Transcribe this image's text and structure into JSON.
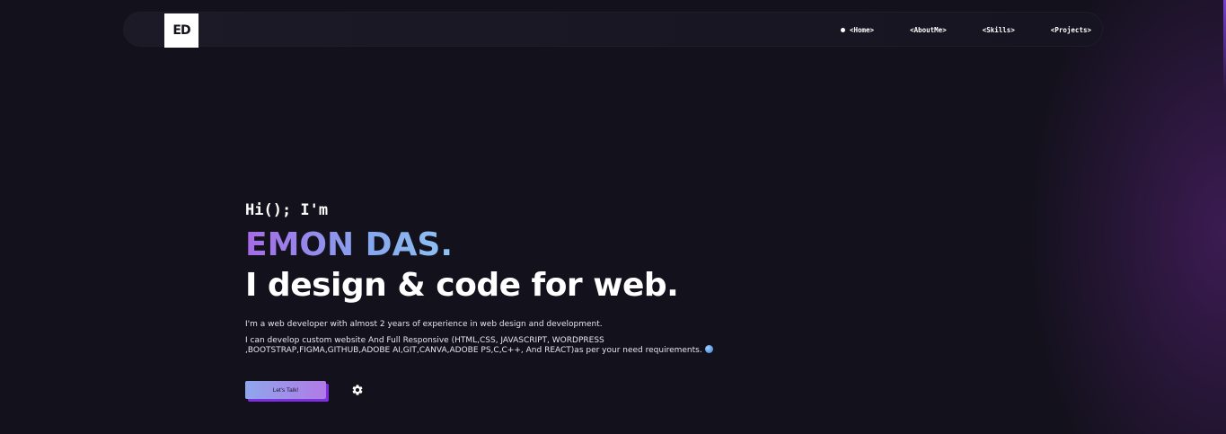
{
  "navbar": {
    "logo": "ED",
    "links": [
      {
        "label": "<Home>",
        "active": true
      },
      {
        "label": "<AboutMe>",
        "active": false
      },
      {
        "label": "<Skills>",
        "active": false
      },
      {
        "label": "<Projects>",
        "active": false
      }
    ]
  },
  "hero": {
    "greeting": "Hi(); I'm",
    "name": "EMON DAS.",
    "tagline": "I design & code for web.",
    "description_1": "I'm a web developer with almost 2 years of experience in web design and development.",
    "description_2": "I can develop custom website And Full Responsive (HTML,CSS, JAVASCRIPT, WORDPRESS ,BOOTSTRAP,FIGMA,GITHUB,ADOBE AI,GIT,CANVA,ADOBE PS,C,C++, And REACT)as per your need requirements.",
    "cta_label": "Let's Talk!"
  },
  "icons": {
    "globe": "globe-icon",
    "settings": "gear-icon"
  },
  "colors": {
    "background": "#13111c",
    "name_gradient_start": "#a66ae6",
    "name_gradient_end": "#8fc4f2",
    "cta_shadow": "#7d2fe0"
  }
}
